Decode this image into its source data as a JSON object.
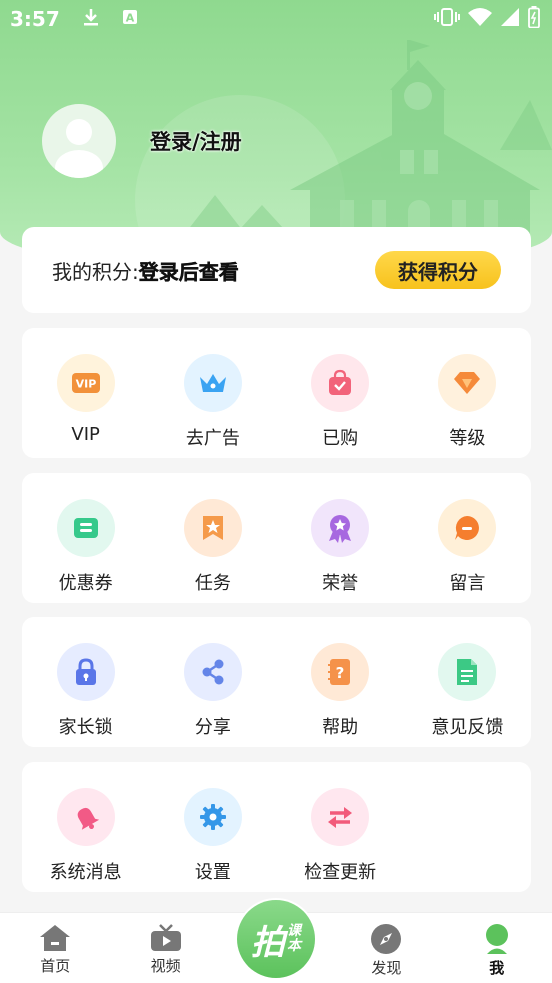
{
  "status_bar": {
    "time": "3:57",
    "left_icons": [
      "download-icon",
      "app-a-icon"
    ],
    "right_icons": [
      "vibrate-icon",
      "wifi-icon",
      "signal-icon",
      "battery-icon"
    ]
  },
  "profile": {
    "login_text": "登录/注册"
  },
  "points": {
    "label": "我的积分:",
    "value": "登录后查看",
    "earn_button": "获得积分"
  },
  "sections": [
    {
      "items": [
        {
          "id": "vip",
          "label": "VIP",
          "icon": "vip-icon",
          "bg": "#fff3dc",
          "color": "#f2913a"
        },
        {
          "id": "remove-ads",
          "label": "去广告",
          "icon": "crown-icon",
          "bg": "#e3f3ff",
          "color": "#3aa3f2"
        },
        {
          "id": "purchased",
          "label": "已购",
          "icon": "shopping-bag-icon",
          "bg": "#ffe7ec",
          "color": "#f2637a"
        },
        {
          "id": "level",
          "label": "等级",
          "icon": "diamond-icon",
          "bg": "#fff1dd",
          "color": "#f58a3a"
        }
      ]
    },
    {
      "items": [
        {
          "id": "coupons",
          "label": "优惠券",
          "icon": "coupon-icon",
          "bg": "#e2f8ef",
          "color": "#36c98b"
        },
        {
          "id": "tasks",
          "label": "任务",
          "icon": "bookmark-star-icon",
          "bg": "#ffe9d6",
          "color": "#f59a4a"
        },
        {
          "id": "honors",
          "label": "荣誉",
          "icon": "medal-icon",
          "bg": "#f1e5fb",
          "color": "#a768e0"
        },
        {
          "id": "messages",
          "label": "留言",
          "icon": "chat-bubble-icon",
          "bg": "#fff0d8",
          "color": "#f57e2e"
        }
      ]
    },
    {
      "items": [
        {
          "id": "parental-lock",
          "label": "家长锁",
          "icon": "lock-icon",
          "bg": "#e6ecff",
          "color": "#5a76e8"
        },
        {
          "id": "share",
          "label": "分享",
          "icon": "share-icon",
          "bg": "#e6ecff",
          "color": "#6485e8"
        },
        {
          "id": "help",
          "label": "帮助",
          "icon": "help-book-icon",
          "bg": "#ffe9d6",
          "color": "#f5924a"
        },
        {
          "id": "feedback",
          "label": "意见反馈",
          "icon": "document-icon",
          "bg": "#e2f8ef",
          "color": "#3cc985"
        }
      ]
    },
    {
      "items": [
        {
          "id": "notifications",
          "label": "系统消息",
          "icon": "bell-icon",
          "bg": "#ffe7ef",
          "color": "#f25a86"
        },
        {
          "id": "settings",
          "label": "设置",
          "icon": "gear-icon",
          "bg": "#e3f3ff",
          "color": "#3597e8"
        },
        {
          "id": "check-update",
          "label": "检查更新",
          "icon": "swap-arrows-icon",
          "bg": "#ffe7ef",
          "color": "#f25a7a"
        }
      ]
    }
  ],
  "tabbar": {
    "tabs": [
      {
        "label": "首页",
        "icon": "home-icon",
        "active": false
      },
      {
        "label": "视频",
        "icon": "tv-icon",
        "active": false
      },
      {
        "label": "",
        "icon": "camera-lesson-icon",
        "active": false
      },
      {
        "label": "发现",
        "icon": "compass-icon",
        "active": false
      },
      {
        "label": "我",
        "icon": "profile-icon",
        "active": true
      }
    ],
    "center_button": {
      "main": "拍",
      "sub": [
        "课",
        "本"
      ]
    }
  },
  "colors": {
    "header_green": "#8fd98f",
    "accent_yellow": "#f7c21d",
    "active_tab": "#5cc25c"
  }
}
